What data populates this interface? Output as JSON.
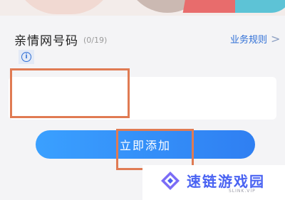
{
  "form": {
    "title": "亲情网号码",
    "counter": "(0/19)",
    "rules_link": "业务规则",
    "rules_chevron": ">",
    "info_icon": "i",
    "phone_input_value": "",
    "phone_input_placeholder": "",
    "add_button_label": "立即添加"
  },
  "watermark": {
    "text": "速链游戏园",
    "sub": "SLINK.VIP"
  },
  "colors": {
    "accent": "#2f7ff2",
    "highlight": "#e07b53",
    "link": "#2f6fd6"
  }
}
